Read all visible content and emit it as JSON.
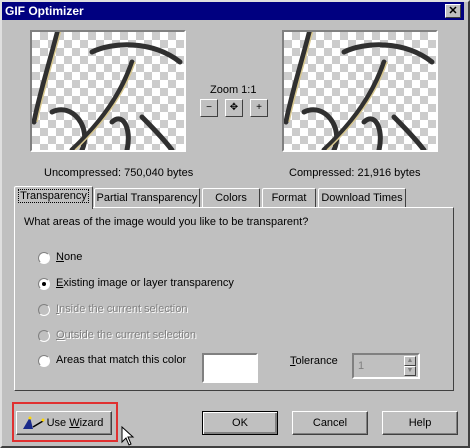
{
  "window": {
    "title": "GIF Optimizer",
    "close_symbol": "✕"
  },
  "preview": {
    "zoom_label": "Zoom 1:1",
    "uncompressed": "Uncompressed:  750,040 bytes",
    "compressed": "Compressed: 21,916 bytes",
    "zoom_out_symbol": "−",
    "pan_symbol": "✥",
    "zoom_in_symbol": "+"
  },
  "tabs": [
    {
      "label": "Transparency",
      "active": true
    },
    {
      "label": "Partial Transparency",
      "active": false
    },
    {
      "label": "Colors",
      "active": false
    },
    {
      "label": "Format",
      "active": false
    },
    {
      "label": "Download Times",
      "active": false
    }
  ],
  "transparency": {
    "question": "What areas of the image would you like to be transparent?",
    "options": [
      {
        "label": "None",
        "mnemonic": "N",
        "rest": "one",
        "selected": false,
        "enabled": true
      },
      {
        "label": "Existing image or layer transparency",
        "mnemonic": "E",
        "rest": "xisting image or layer transparency",
        "selected": true,
        "enabled": true
      },
      {
        "label": "Inside the current selection",
        "mnemonic": "I",
        "rest": "nside the current selection",
        "selected": false,
        "enabled": false
      },
      {
        "label": "Outside the current selection",
        "mnemonic": "O",
        "rest": "utside the current selection",
        "selected": false,
        "enabled": false
      },
      {
        "label": "Areas that match this color",
        "mnemonic": "",
        "rest": "Areas that match this color",
        "selected": false,
        "enabled": true
      }
    ],
    "tolerance_label_mnemonic": "T",
    "tolerance_label_rest": "olerance",
    "tolerance_value": "1"
  },
  "buttons": {
    "wizard_pre": "Use ",
    "wizard_mnemonic": "W",
    "wizard_rest": "izard",
    "ok": "OK",
    "cancel": "Cancel",
    "help": "Help"
  }
}
